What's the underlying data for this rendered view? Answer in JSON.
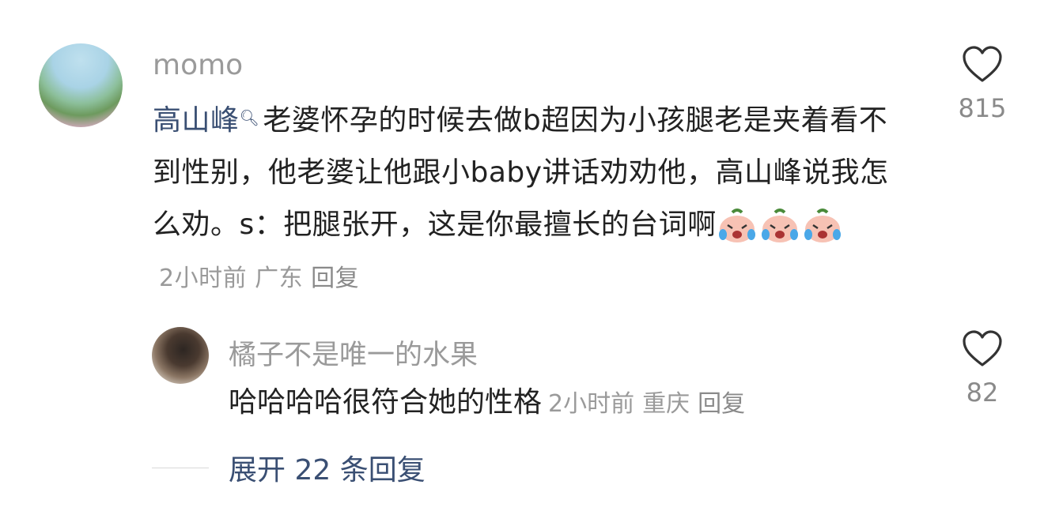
{
  "comment": {
    "username": "momo",
    "mention": "高山峰",
    "mention_icon": "search-icon",
    "text": "老婆怀孕的时候去做b超因为小孩腿老是夹着看不到性别，他老婆让他跟小baby讲话劝劝他，高山峰说我怎么劝。s：把腿张开，这是你最擅长的台词啊",
    "emoji": "crying-laughing-face",
    "time": "2小时前",
    "location": "广东",
    "reply_label": "回复",
    "likes": "815"
  },
  "reply": {
    "username": "橘子不是唯一的水果",
    "text": "哈哈哈哈很符合她的性格",
    "time": "2小时前",
    "location": "重庆",
    "reply_label": "回复",
    "likes": "82"
  },
  "expand_label": "展开 22 条回复",
  "colors": {
    "mention": "#3a4f73",
    "meta": "#9a9a9a",
    "text": "#222222"
  }
}
